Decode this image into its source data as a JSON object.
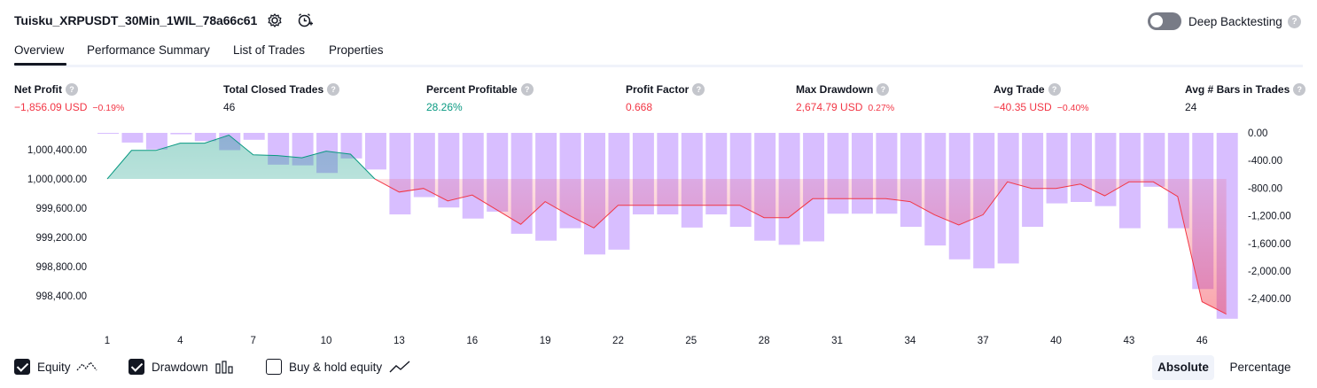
{
  "header": {
    "title": "Tuisku_XRPUSDT_30Min_1WIL_78a66c61",
    "deep_backtesting_label": "Deep Backtesting",
    "deep_backtesting_on": false,
    "help_glyph": "?"
  },
  "tabs": [
    {
      "label": "Overview",
      "active": true
    },
    {
      "label": "Performance Summary",
      "active": false
    },
    {
      "label": "List of Trades",
      "active": false
    },
    {
      "label": "Properties",
      "active": false
    }
  ],
  "stats": [
    {
      "label": "Net Profit",
      "value": "−1,856.09 USD",
      "pct": "−0.19%",
      "tone": "neg"
    },
    {
      "label": "Total Closed Trades",
      "value": "46",
      "pct": "",
      "tone": "neutral"
    },
    {
      "label": "Percent Profitable",
      "value": "28.26%",
      "pct": "",
      "tone": "pos"
    },
    {
      "label": "Profit Factor",
      "value": "0.668",
      "pct": "",
      "tone": "neg"
    },
    {
      "label": "Max Drawdown",
      "value": "2,674.79 USD",
      "pct": "0.27%",
      "tone": "neg"
    },
    {
      "label": "Avg Trade",
      "value": "−40.35 USD",
      "pct": "−0.40%",
      "tone": "neg"
    },
    {
      "label": "Avg # Bars in Trades",
      "value": "24",
      "pct": "",
      "tone": "neutral"
    }
  ],
  "chart_data": {
    "type": "line",
    "x": [
      1,
      2,
      3,
      4,
      5,
      6,
      7,
      8,
      9,
      10,
      11,
      12,
      13,
      14,
      15,
      16,
      17,
      18,
      19,
      20,
      21,
      22,
      23,
      24,
      25,
      26,
      27,
      28,
      29,
      30,
      31,
      32,
      33,
      34,
      35,
      36,
      37,
      38,
      39,
      40,
      41,
      42,
      43,
      44,
      45,
      46,
      47
    ],
    "x_ticks": [
      "1",
      "4",
      "7",
      "10",
      "13",
      "16",
      "19",
      "22",
      "25",
      "28",
      "31",
      "34",
      "37",
      "40",
      "43",
      "46"
    ],
    "left_axis": {
      "ticks": [
        "1,000,400.00",
        "1,000,000.00",
        "999,600.00",
        "999,200.00",
        "998,800.00",
        "998,400.00"
      ],
      "baseline": 1000000
    },
    "right_axis": {
      "ticks": [
        "0.00",
        "-400.00",
        "-800.00",
        "-1,200.00",
        "-1,600.00",
        "-2,000.00",
        "-2,400.00"
      ]
    },
    "series": [
      {
        "name": "Equity",
        "color": "#f23645",
        "positive_color": "#089981",
        "values": [
          1000000,
          1000390,
          1000390,
          1000490,
          1000490,
          1000600,
          1000330,
          1000320,
          1000290,
          1000380,
          1000340,
          1000000,
          999820,
          999870,
          999700,
          999780,
          999580,
          999380,
          999690,
          999500,
          999330,
          999640,
          999640,
          999640,
          999640,
          999640,
          999640,
          999470,
          999470,
          999730,
          999730,
          999730,
          999730,
          999690,
          999510,
          999370,
          999510,
          999960,
          999870,
          999870,
          999930,
          999770,
          999960,
          999960,
          999760,
          998320,
          998150
        ]
      },
      {
        "name": "Drawdown",
        "color": "#d1b3ff",
        "values": [
          0,
          -140,
          -240,
          -20,
          -120,
          -250,
          -100,
          -460,
          -470,
          -580,
          -370,
          -530,
          -1180,
          -930,
          -1080,
          -1240,
          -1140,
          -1460,
          -1560,
          -1380,
          -1760,
          -1690,
          -1180,
          -1180,
          -1370,
          -1180,
          -1360,
          -1560,
          -1620,
          -1570,
          -1170,
          -1170,
          -1170,
          -1360,
          -1630,
          -1830,
          -1960,
          -1890,
          -1360,
          -1020,
          -1000,
          -1060,
          -1380,
          -780,
          -1380,
          -2260,
          -2690
        ]
      }
    ]
  },
  "footer": {
    "legend": [
      {
        "label": "Equity",
        "checked": true,
        "icon": "equity-line-icon"
      },
      {
        "label": "Drawdown",
        "checked": true,
        "icon": "drawdown-bars-icon"
      },
      {
        "label": "Buy & hold equity",
        "checked": false,
        "icon": "buy-hold-line-icon"
      }
    ],
    "absolute_label": "Absolute",
    "percentage_label": "Percentage",
    "active_mode": "Absolute"
  }
}
